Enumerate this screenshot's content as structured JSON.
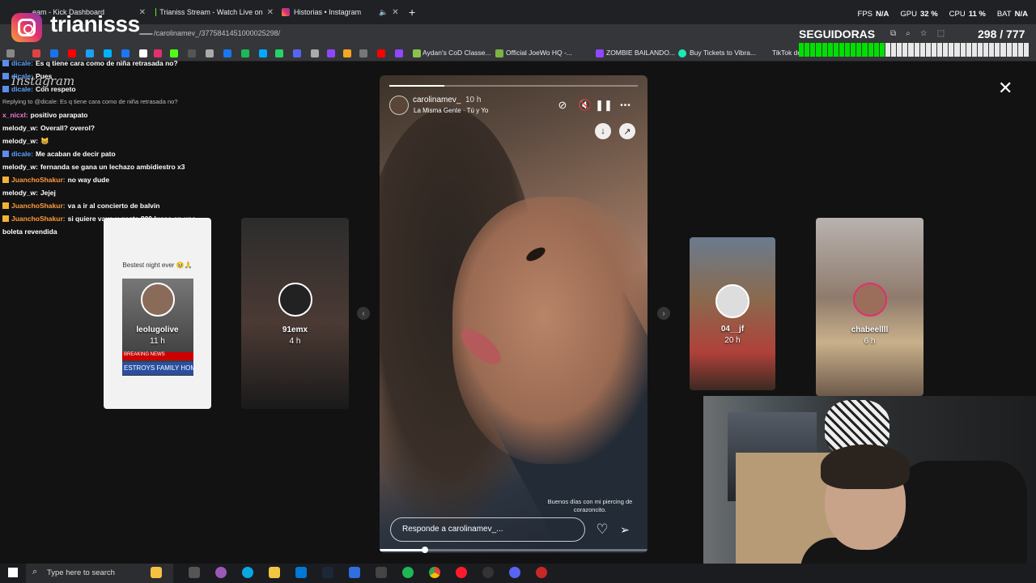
{
  "browser": {
    "tabs": [
      {
        "label": "eam - Kick Dashboard",
        "close": "✕"
      },
      {
        "label": "Trianiss Stream - Watch Live on",
        "close": "✕"
      },
      {
        "label": "Historias • Instagram",
        "close": "✕"
      }
    ],
    "new_tab": "+",
    "url": "/carolinamev_/3775841451000025298/",
    "bookmarks": [
      "Aydan's CoD Classe...",
      "Official JoeWo HQ -...",
      "ZOMBIE BAILANDO...",
      "Buy Tickets to Vibra...",
      "TikTok de"
    ]
  },
  "overlay": {
    "streamer_name": "trianisss_",
    "instagram_word": "Instagram",
    "stats": [
      {
        "label": "FPS",
        "value": "N/A"
      },
      {
        "label": "GPU",
        "value": "32 %"
      },
      {
        "label": "CPU",
        "value": "11 %"
      },
      {
        "label": "BAT",
        "value": "N/A"
      }
    ],
    "followers_label": "SEGUIDORAS",
    "followers_count": "298 / 777",
    "followers_progress": 0.384
  },
  "chat": [
    {
      "user": "dicale:",
      "text": "Es q tiene cara como de niña retrasada no?",
      "color": "blue",
      "badge": "b1"
    },
    {
      "user": "dicale:",
      "text": "Pues",
      "color": "blue",
      "badge": "b1"
    },
    {
      "user": "dicale:",
      "text": "Con respeto",
      "color": "blue",
      "badge": "b1"
    },
    {
      "user": "",
      "text": "Replying to @dicale: Es q tiene cara como de niña retrasada no?",
      "color": "",
      "badge": "",
      "reply": true
    },
    {
      "user": "x_nicxl:",
      "text": "positivo parapato",
      "color": "pink",
      "badge": ""
    },
    {
      "user": "melody_w:",
      "text": "Overall? overol?",
      "color": "",
      "badge": ""
    },
    {
      "user": "melody_w:",
      "text": "😸",
      "color": "",
      "badge": ""
    },
    {
      "user": "dicale:",
      "text": "Me acaban de decir pato",
      "color": "blue",
      "badge": "b1"
    },
    {
      "user": "melody_w:",
      "text": "fernanda se gana un lechazo ambidiestro x3",
      "color": "",
      "badge": ""
    },
    {
      "user": "JuanchoShakur:",
      "text": "no way dude",
      "color": "orange",
      "badge": "b2"
    },
    {
      "user": "melody_w:",
      "text": "Jejej",
      "color": "",
      "badge": ""
    },
    {
      "user": "JuanchoShakur:",
      "text": "va a ir al concierto de balvin",
      "color": "orange",
      "badge": "b2"
    },
    {
      "user": "JuanchoShakur:",
      "text": "si quiere vaya y gasta 800 lucas en una",
      "color": "orange",
      "badge": "b2"
    },
    {
      "user": "",
      "text": "boleta revendida",
      "color": "",
      "badge": ""
    }
  ],
  "side_stories": [
    {
      "name": "leolugolive",
      "time": "11 h",
      "caption": "Bestest night ever 🥹🙏",
      "banner": "BREAKING NEWS",
      "banner2": "ESTROYS FAMILY HOM"
    },
    {
      "name": "91emx",
      "time": "4 h"
    },
    {
      "name": "04__jf",
      "time": "20 h"
    },
    {
      "name": "chabeellll",
      "time": "6 h"
    }
  ],
  "story": {
    "username": "carolinamev_",
    "time": "10 h",
    "song": "La Misma Gente · Tú y Yo",
    "caption": "Buenos días con mi piercing de corazoncito.",
    "reply_placeholder": "Responde a carolinamev_...",
    "progress": 0.22,
    "video_progress": 0.17
  },
  "icons": {
    "close": "✕",
    "more": "•••",
    "heart": "♡",
    "send": "➢",
    "prev": "‹",
    "next": "›"
  },
  "taskbar": {
    "search_placeholder": "Type here to search"
  }
}
